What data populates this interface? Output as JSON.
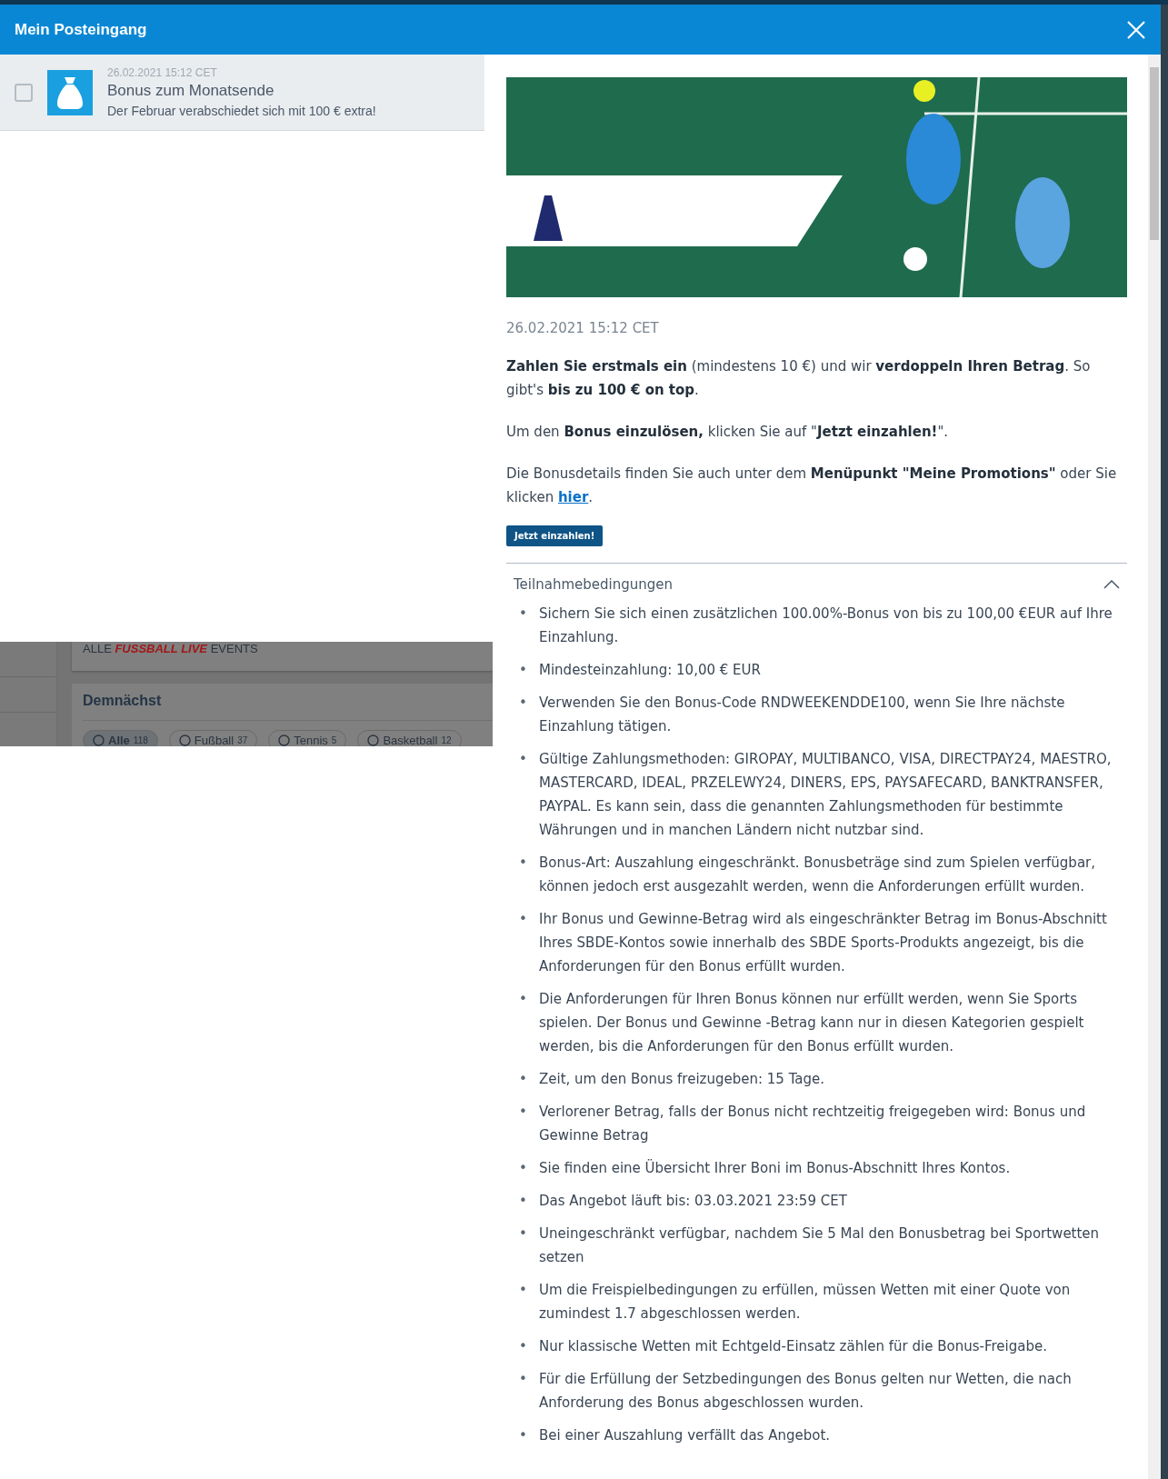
{
  "header": {
    "title": "Mein Posteingang"
  },
  "messages": [
    {
      "checked": false,
      "selected": true,
      "date": "26.02.2021 15:12 CET",
      "subject": "Bonus zum Monatsende",
      "preview": "Der Februar verabschiedet sich mit 100 € extra!"
    }
  ],
  "background_page": {
    "banner": {
      "prefix": "ALLE",
      "highlight": "FUSSBALL LIVE",
      "suffix": "EVENTS"
    },
    "section_title": "Demnächst",
    "chips": [
      {
        "label": "Alle",
        "count": "118",
        "selected": true
      },
      {
        "label": "Fußball",
        "count": "37",
        "selected": false
      },
      {
        "label": "Tennis",
        "count": "5",
        "selected": false
      },
      {
        "label": "Basketball",
        "count": "12",
        "selected": false
      }
    ]
  },
  "message": {
    "date": "26.02.2021 15:12 CET",
    "paragraphs": [
      {
        "text": "**Zahlen Sie erstmals ein** (mindestens 10 €) und wir **verdoppeln Ihren Betrag**. So gibt's **bis zu 100 € on top**."
      },
      {
        "text": "Um den **Bonus einzulösen,** klicken Sie auf \"**Jetzt einzahlen!**\"."
      },
      {
        "text": "Die Bonusdetails finden Sie auch unter dem **Menüpunkt \"Meine Promotions\"** oder Sie klicken ",
        "link": "hier",
        "after": "."
      }
    ],
    "button": "Jetzt einzahlen!",
    "terms": {
      "title": "Teilnahmebedingungen",
      "expanded": true,
      "marker": "•",
      "items": [
        "Sichern Sie sich einen zusätzlichen 100.00%-Bonus von bis zu 100,00 €EUR auf Ihre Einzahlung.",
        "Mindesteinzahlung: 10,00 € EUR",
        "Verwenden Sie den Bonus-Code RNDWEEKENDDE100, wenn Sie Ihre nächste Einzahlung tätigen.",
        "Gültige Zahlungsmethoden: GIROPAY, MULTIBANCO, VISA, DIRECTPAY24, MAESTRO, MASTERCARD, IDEAL, PRZELEWY24, DINERS, EPS, PAYSAFECARD, BANKTRANSFER, PAYPAL. Es kann sein, dass die genannten Zahlungsmethoden für bestimmte Währungen und in manchen Ländern nicht nutzbar sind.",
        "Bonus-Art: Auszahlung eingeschränkt. Bonusbeträge sind zum Spielen verfügbar, können jedoch erst ausgezahlt werden, wenn die Anforderungen erfüllt wurden.",
        "Ihr Bonus und Gewinne-Betrag wird als eingeschränkter Betrag im Bonus-Abschnitt Ihres SBDE-Kontos sowie innerhalb des SBDE Sports-Produkts angezeigt, bis die Anforderungen für den Bonus erfüllt wurden.",
        "Die Anforderungen für Ihren Bonus können nur erfüllt werden, wenn Sie Sports spielen. Der Bonus und Gewinne -Betrag kann nur in diesen Kategorien gespielt werden, bis die Anforderungen für den Bonus erfüllt wurden.",
        "Zeit, um den Bonus freizugeben: 15 Tage.",
        "Verlorener Betrag, falls der Bonus nicht rechtzeitig freigegeben wird: Bonus und Gewinne Betrag",
        "Sie finden eine Übersicht Ihrer Boni im Bonus-Abschnitt Ihres Kontos.",
        "Das Angebot läuft bis: 03.03.2021 23:59 CET",
        "Uneingeschränkt verfügbar, nachdem Sie 5 Mal den Bonusbetrag bei Sportwetten setzen",
        "Um die Freispielbedingungen zu erfüllen, müssen Wetten mit einer Quote von zumindest 1.7 abgeschlossen werden.",
        "Nur klassische Wetten mit Echtgeld-Einsatz zählen für die Bonus-Freigabe.",
        "Für die Erfüllung der Setzbedingungen des Bonus gelten nur Wetten, die nach Anforderung des Bonus abgeschlossen wurden.",
        "Bei einer Auszahlung verfällt das Angebot."
      ]
    }
  }
}
